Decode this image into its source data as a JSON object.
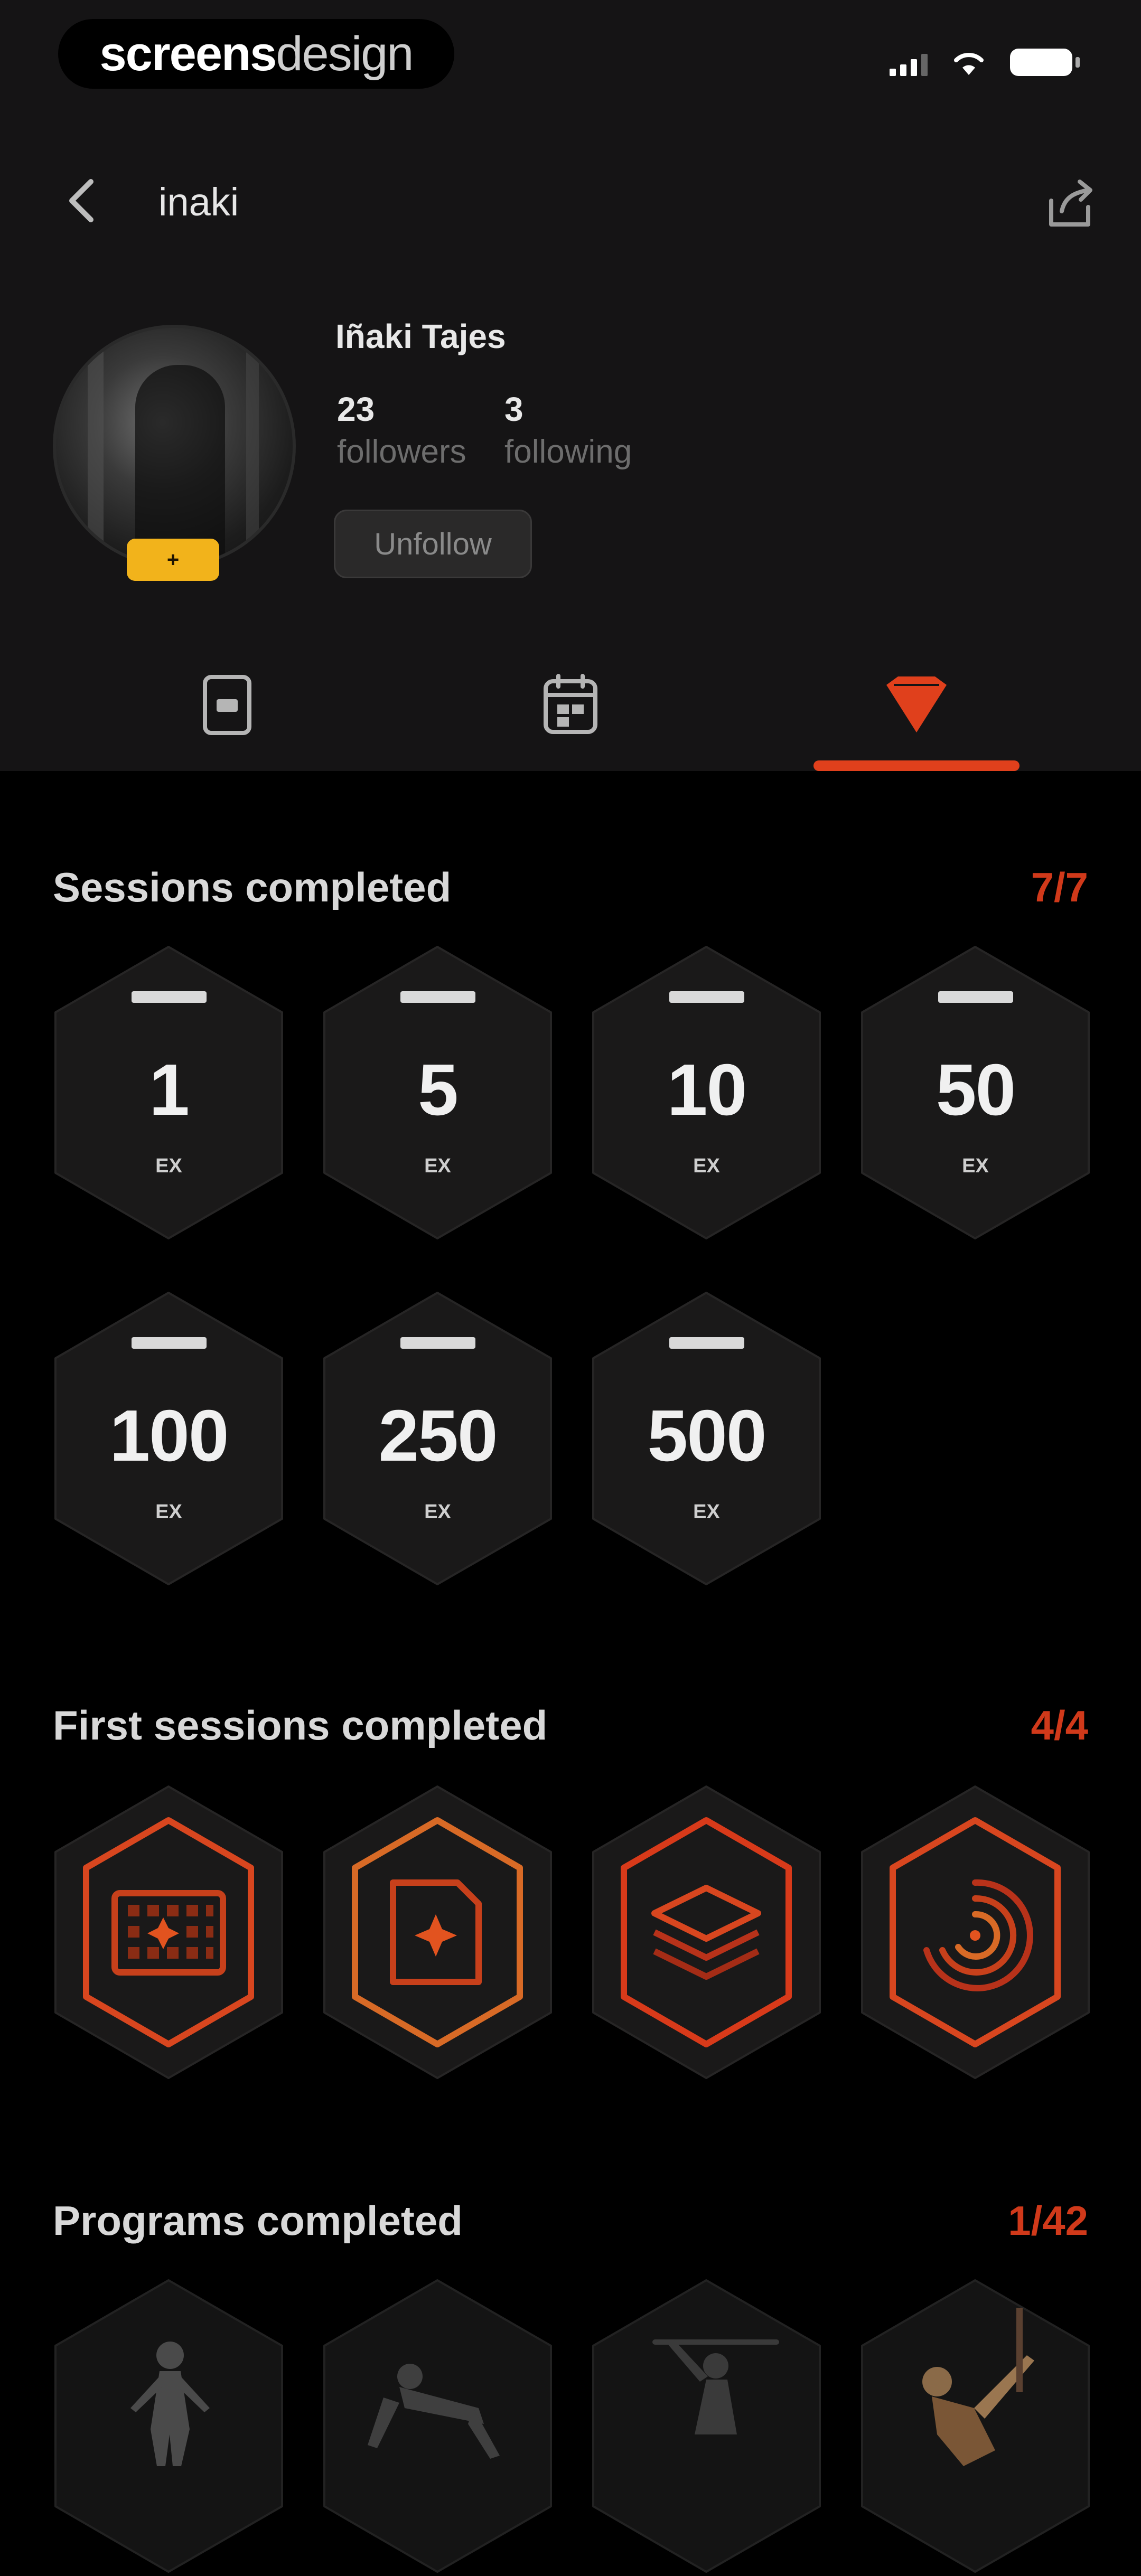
{
  "watermark": {
    "bold": "screens",
    "light": "design"
  },
  "nav": {
    "title": "inaki"
  },
  "profile": {
    "name": "Iñaki Tajes",
    "followers_count": "23",
    "followers_label": "followers",
    "following_count": "3",
    "following_label": "following",
    "badge": "+",
    "unfollow_label": "Unfollow"
  },
  "tabs": [
    "document-icon",
    "calendar-icon",
    "trophy-icon"
  ],
  "accent": "#e0401c",
  "sections": {
    "sessions": {
      "title": "Sessions completed",
      "count": "7/7",
      "badges": [
        {
          "value": "1",
          "unit": "EX"
        },
        {
          "value": "5",
          "unit": "EX"
        },
        {
          "value": "10",
          "unit": "EX"
        },
        {
          "value": "50",
          "unit": "EX"
        },
        {
          "value": "100",
          "unit": "EX"
        },
        {
          "value": "250",
          "unit": "EX"
        },
        {
          "value": "500",
          "unit": "EX"
        }
      ]
    },
    "first_sessions": {
      "title": "First sessions completed",
      "count": "4/4",
      "badges": [
        "calendar-grid-icon",
        "document-plus-icon",
        "stack-layers-icon",
        "concentric-arcs-icon"
      ]
    },
    "programs": {
      "title": "Programs completed",
      "count": "1/42"
    }
  }
}
